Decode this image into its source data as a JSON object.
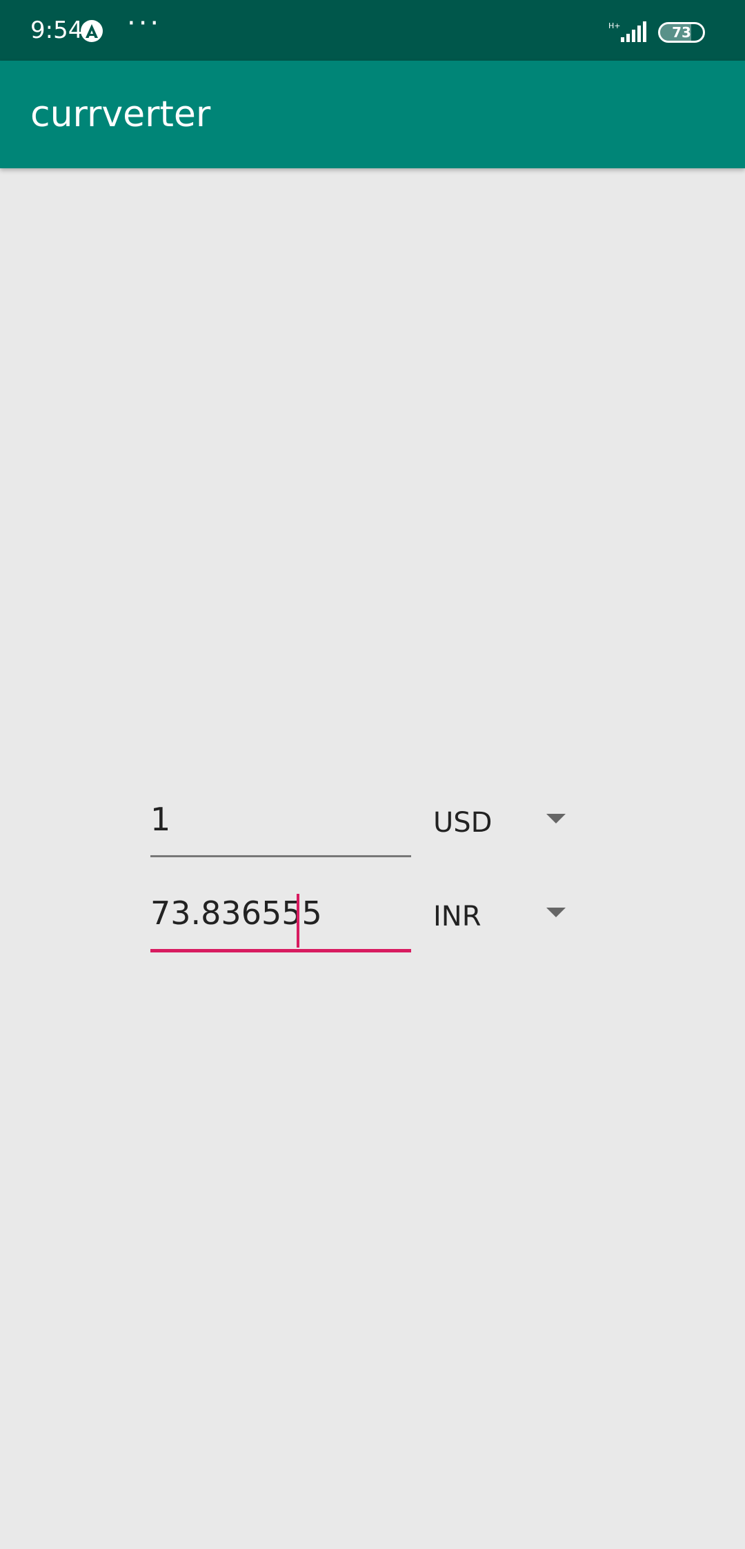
{
  "status_bar": {
    "time": "9:54",
    "dots": "···",
    "network": "H+",
    "battery": "73",
    "battery_level": 0.73
  },
  "app_bar": {
    "title": "currverter"
  },
  "converter": {
    "from": {
      "amount": "1",
      "currency": "USD"
    },
    "to": {
      "amount": "73.836555",
      "currency": "INR"
    }
  },
  "colors": {
    "status_bar": "#00574b",
    "app_bar": "#008577",
    "accent": "#d81b60",
    "background": "#e9e9e9"
  }
}
